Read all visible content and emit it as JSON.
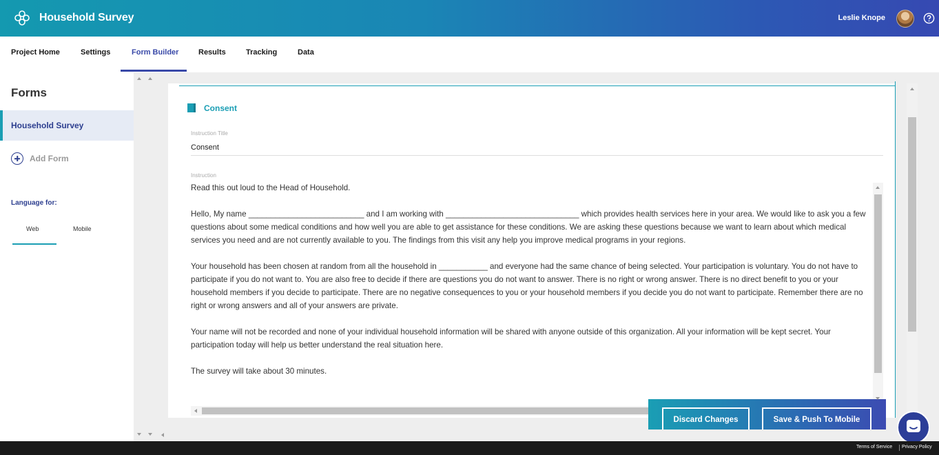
{
  "header": {
    "app_title": "Household Survey",
    "user_name": "Leslie Knope",
    "brand_color_start": "#1499b0",
    "brand_color_end": "#3649b2"
  },
  "nav": {
    "items": [
      {
        "label": "Project Home"
      },
      {
        "label": "Settings"
      },
      {
        "label": "Form Builder",
        "active": true
      },
      {
        "label": "Results"
      },
      {
        "label": "Tracking"
      },
      {
        "label": "Data"
      }
    ]
  },
  "sidebar": {
    "heading": "Forms",
    "forms": [
      {
        "label": "Household Survey",
        "selected": true
      }
    ],
    "add_form_label": "Add Form",
    "language_label": "Language for:",
    "language_tabs": [
      {
        "label": "Web",
        "active": true
      },
      {
        "label": "Mobile"
      }
    ]
  },
  "section": {
    "title": "Consent",
    "instruction_title_label": "Instruction Title",
    "instruction_title_value": "Consent",
    "instruction_label": "Instruction",
    "instruction_paragraphs": [
      "Read this out loud to the Head of Household.",
      "Hello, My name __________________________ and I am working with ______________________________ which provides health services here in your area. We would like to ask you a few questions about some medical conditions and how well you are able to get assistance for these conditions. We are asking these questions because we want to learn about which medical services you need and are not currently available to you. The findings from this visit any help you improve medical programs in your regions.",
      "Your household has been chosen at random from all the household in ___________ and everyone had the same chance of being selected. Your participation is voluntary. You do not have to participate if you do not want to. You are also free to decide if there are questions you do not want to answer. There is no right or wrong answer. There is no direct benefit to you or your household members if you decide to participate. There are no negative consequences to you or your household members if you decide you do not want to participate. Remember there are no right or wrong answers and all of your answers are private.",
      "Your name will not be recorded and none of your individual household information will be shared with anyone outside of this organization. All your information will be kept secret. Your participation today will help us better understand the real situation here.",
      "The survey will take about 30 minutes."
    ]
  },
  "actions": {
    "discard_label": "Discard Changes",
    "save_label": "Save & Push To Mobile"
  },
  "footer": {
    "terms_label": "Terms of Service",
    "privacy_label": "Privacy Policy"
  }
}
